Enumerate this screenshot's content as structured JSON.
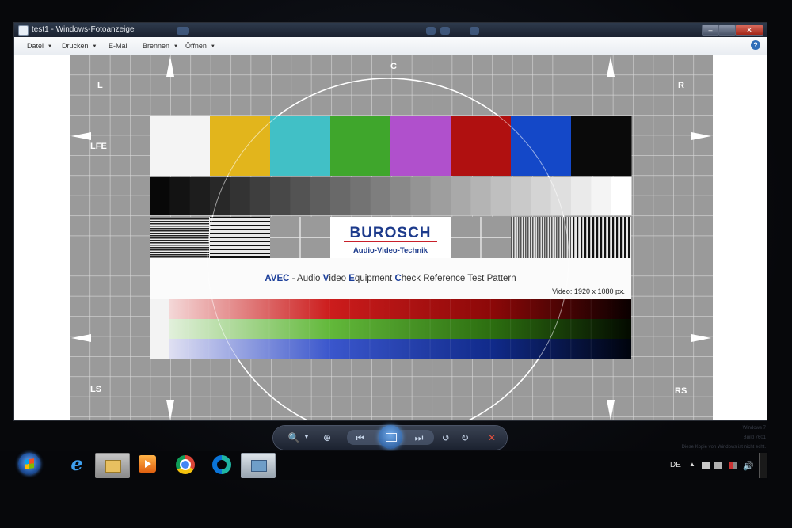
{
  "window": {
    "title": "test1 - Windows-Fotoanzeige",
    "menu": [
      {
        "label": "Datei",
        "has_arrow": true
      },
      {
        "label": "Drucken",
        "has_arrow": true
      },
      {
        "label": "E-Mail",
        "has_arrow": false
      },
      {
        "label": "Brennen",
        "has_arrow": true
      },
      {
        "label": "Öffnen",
        "has_arrow": true
      }
    ],
    "help_label": "?",
    "controls": {
      "minimize": "–",
      "maximize": "□",
      "close": "✕"
    }
  },
  "test_pattern": {
    "labels": {
      "top": "C",
      "left_top": "L",
      "right_top": "R",
      "left_mid": "LFE",
      "left_bottom": "LS",
      "right_bottom": "RS"
    },
    "brand": "BUROSCH",
    "brand_sub": "Audio-Video-Technik",
    "headline_parts": [
      {
        "text": "AVEC",
        "accent": true
      },
      {
        "text": " - Audio ",
        "accent": false
      },
      {
        "text": "V",
        "accent": true
      },
      {
        "text": "ideo ",
        "accent": false
      },
      {
        "text": "E",
        "accent": true
      },
      {
        "text": "quipment ",
        "accent": false
      },
      {
        "text": "C",
        "accent": true
      },
      {
        "text": "heck Reference Test Pattern",
        "accent": false
      }
    ],
    "resolution": "Video: 1920 x 1080 px.",
    "color_bars": [
      "#f4f4f4",
      "#e2b51c",
      "#41c0c6",
      "#3fa62c",
      "#b050cc",
      "#b01010",
      "#1448c8",
      "#0a0a0a"
    ],
    "accent_color": "#1c3f9a",
    "brand_color": "#1d3b8c"
  },
  "viewer_toolbar": {
    "icons": [
      "zoom-icon",
      "fit-window-icon",
      "previous-icon",
      "slideshow-icon",
      "next-icon",
      "rotate-left-icon",
      "rotate-right-icon",
      "delete-icon"
    ]
  },
  "watermark": {
    "line1": "Windows 7",
    "line2": "Build 7601",
    "line3": "Diese Kopie von Windows ist nicht echt."
  },
  "taskbar": {
    "icons": [
      "start-icon",
      "internet-explorer-icon",
      "explorer-icon",
      "media-player-icon",
      "chrome-icon",
      "edge-icon",
      "photo-viewer-icon"
    ],
    "language": "DE"
  }
}
